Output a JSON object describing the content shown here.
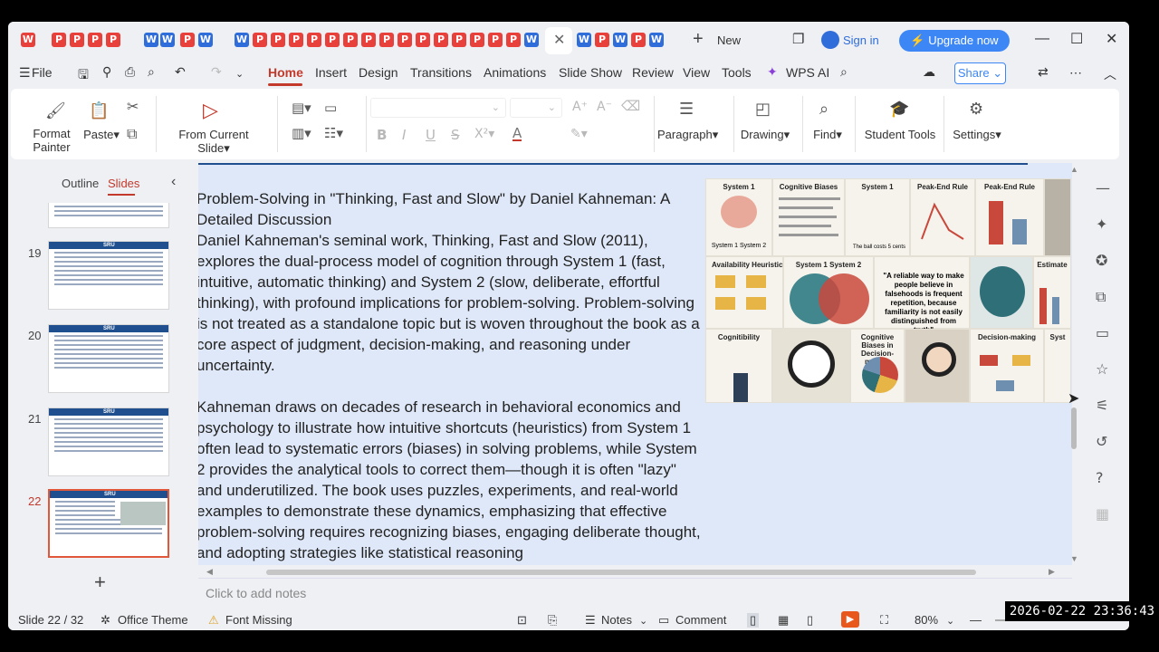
{
  "tabs": {
    "doc_tabs": [
      {
        "type": "wps",
        "letter": "W"
      },
      {
        "type": "p",
        "letter": "P"
      },
      {
        "type": "p",
        "letter": "P"
      },
      {
        "type": "p",
        "letter": "P"
      },
      {
        "type": "p",
        "letter": "P"
      },
      {
        "type": "w",
        "letter": "W"
      },
      {
        "type": "w",
        "letter": "W"
      },
      {
        "type": "p",
        "letter": "P"
      },
      {
        "type": "w",
        "letter": "W"
      },
      {
        "type": "w",
        "letter": "W"
      },
      {
        "type": "p",
        "letter": "P"
      },
      {
        "type": "p",
        "letter": "P"
      },
      {
        "type": "p",
        "letter": "P"
      },
      {
        "type": "p",
        "letter": "P"
      },
      {
        "type": "p",
        "letter": "P"
      },
      {
        "type": "p",
        "letter": "P"
      },
      {
        "type": "p",
        "letter": "P"
      },
      {
        "type": "p",
        "letter": "P"
      },
      {
        "type": "p",
        "letter": "P"
      },
      {
        "type": "p",
        "letter": "P"
      },
      {
        "type": "p",
        "letter": "P"
      },
      {
        "type": "p",
        "letter": "P"
      },
      {
        "type": "p",
        "letter": "P"
      },
      {
        "type": "p",
        "letter": "P"
      },
      {
        "type": "p",
        "letter": "P"
      },
      {
        "type": "w",
        "letter": "W"
      },
      {
        "type": "w",
        "letter": "W"
      },
      {
        "type": "p",
        "letter": "P"
      },
      {
        "type": "w",
        "letter": "W"
      },
      {
        "type": "p",
        "letter": "P"
      },
      {
        "type": "w",
        "letter": "W"
      }
    ],
    "new_label": "New",
    "sign_in": "Sign in",
    "upgrade": "Upgrade now"
  },
  "menu": {
    "file": "File",
    "items": [
      "Home",
      "Insert",
      "Design",
      "Transitions",
      "Animations",
      "Slide Show",
      "Review",
      "View",
      "Tools"
    ],
    "wps_ai": "WPS AI",
    "share": "Share"
  },
  "ribbon": {
    "format_painter_1": "Format",
    "format_painter_2": "Painter",
    "paste": "Paste",
    "from_current": "From Current Slide",
    "paragraph": "Paragraph",
    "drawing": "Drawing",
    "find": "Find",
    "student_tools": "Student Tools",
    "settings": "Settings"
  },
  "panel": {
    "outline": "Outline",
    "slides": "Slides",
    "slide_numbers": [
      "19",
      "20",
      "21",
      "22"
    ],
    "thumb_brand": "SRU"
  },
  "slide": {
    "para1": "Problem-Solving in \"Thinking, Fast and Slow\" by Daniel Kahneman: A Detailed Discussion\nDaniel Kahneman's seminal work, Thinking, Fast and Slow (2011), explores the dual-process model of cognition through System 1 (fast, intuitive, automatic thinking) and System 2 (slow, deliberate, effortful thinking), with profound implications for problem-solving. Problem-solving is not treated as a standalone topic but is woven throughout the book as a core aspect of judgment, decision-making, and reasoning under uncertainty.",
    "para2": "Kahneman draws on decades of research in behavioral economics and psychology to illustrate how intuitive shortcuts (heuristics) from System 1 often lead to systematic errors (biases) in solving problems, while System 2 provides the analytical tools to correct them—though it is often \"lazy\" and underutilized. The book uses puzzles, experiments, and real-world examples to demonstrate these dynamics, emphasizing that effective problem-solving requires recognizing biases, engaging deliberate thought, and adopting strategies like statistical reasoning",
    "image_panels": {
      "system1": "System 1",
      "cognitive_biases": "Cognitive Biases",
      "system1b": "System 1",
      "peak_end": "Peak-End Rule",
      "peak_end2": "Peak-End Rule",
      "availability": "Availability Heuristic",
      "system1_2": "System 1   System 2",
      "quote": "\"A reliable way to make people believe in falsehoods is frequent repetition, because familiarity is not easily distinguished from truth\"",
      "estimate": "Estimate",
      "cognitibility": "Cognitibility",
      "biases_decision": "Cognitive Biases in Decision-making",
      "decision_making": "Decision-making",
      "sys_partial": "Syst",
      "bat_ball": "The ball costs 5 cents"
    }
  },
  "notes": {
    "placeholder": "Click to add notes"
  },
  "status": {
    "slide_count": "Slide 22 / 32",
    "theme": "Office Theme",
    "font_missing": "Font Missing",
    "notes": "Notes",
    "comment": "Comment",
    "zoom": "80%",
    "timestamp": "2026-02-22  23:36:43"
  }
}
